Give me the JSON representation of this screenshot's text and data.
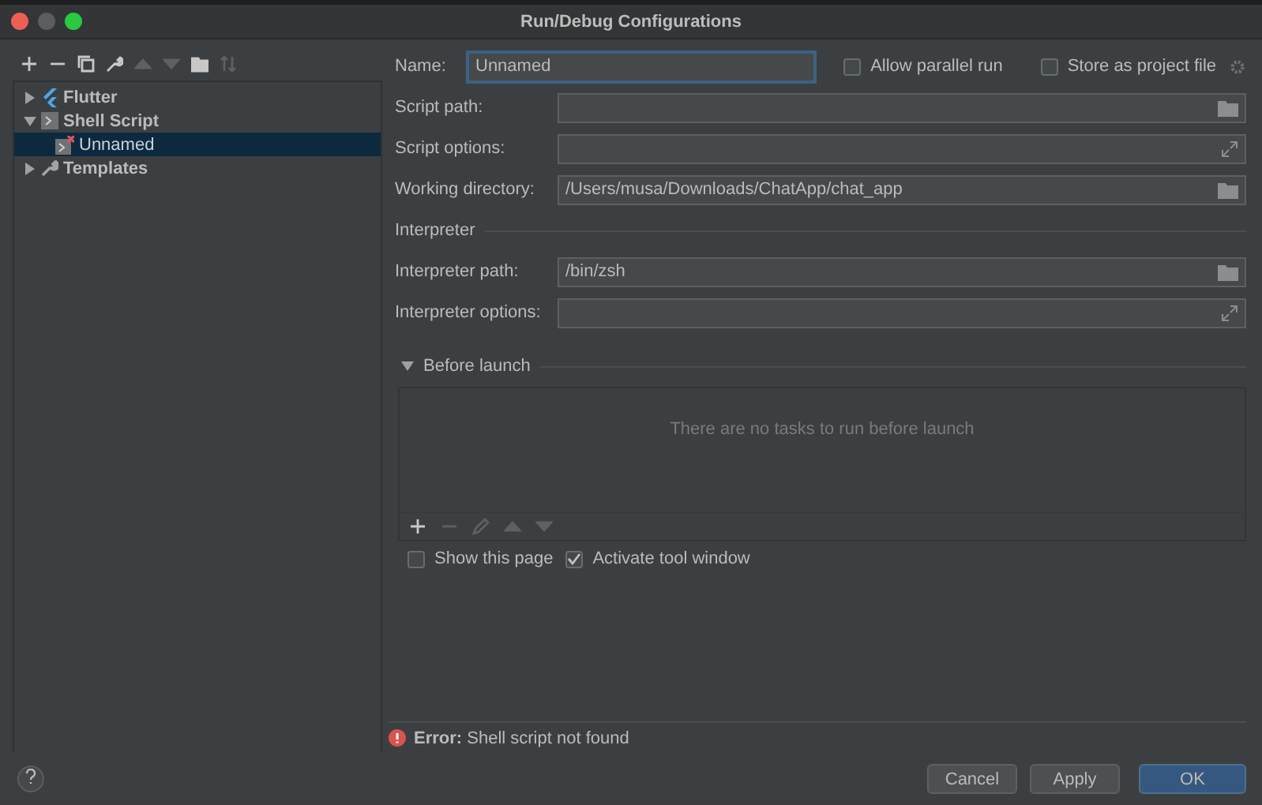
{
  "window": {
    "title": "Run/Debug Configurations"
  },
  "tree": [
    {
      "label": "Flutter",
      "kind": "flutter",
      "expanded": false,
      "selected": false
    },
    {
      "label": "Shell Script",
      "kind": "shell",
      "expanded": true,
      "selected": false,
      "children": [
        {
          "label": "Unnamed",
          "kind": "config",
          "selected": true
        }
      ]
    },
    {
      "label": "Templates",
      "kind": "templates",
      "expanded": false,
      "selected": false
    }
  ],
  "name": {
    "label": "Name:",
    "value": "Unnamed"
  },
  "header_options": [
    {
      "label": "Allow parallel run",
      "checked": false
    },
    {
      "label": "Store as project file",
      "checked": false
    }
  ],
  "fields": [
    {
      "label": "Script path:",
      "kind": "browse"
    },
    {
      "label": "Script options:",
      "kind": "expand"
    },
    {
      "label": "Working directory:",
      "value": "/Users/musa/Downloads/ChatApp/chat_app",
      "kind": "browse"
    }
  ],
  "interpreter": {
    "title": "Interpreter",
    "fields": [
      {
        "label": "Interpreter path:",
        "value": "/bin/zsh",
        "kind": "browse"
      },
      {
        "label": "Interpreter options:",
        "kind": "expand"
      }
    ]
  },
  "before_launch": {
    "title": "Before launch",
    "expanded": true,
    "empty_text": "There are no tasks to run before launch"
  },
  "launch_options": [
    {
      "label": "Show this page",
      "checked": false
    },
    {
      "label": "Activate tool window",
      "checked": true
    }
  ],
  "error": "**Error:** Shell script not found",
  "buttons": [
    {
      "label": "Cancel",
      "primary": false
    },
    {
      "label": "Apply",
      "primary": false
    },
    {
      "label": "OK",
      "primary": true
    }
  ]
}
